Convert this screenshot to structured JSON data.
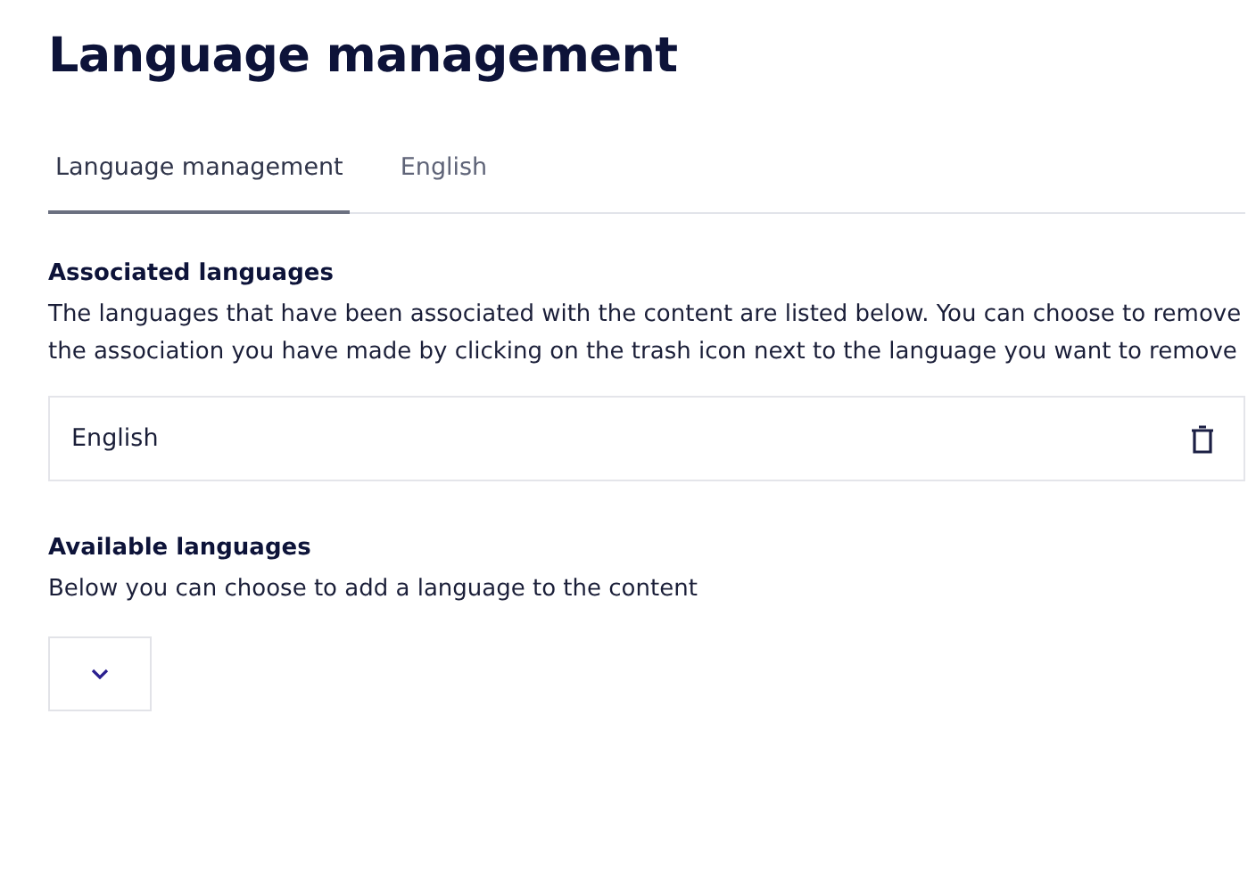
{
  "title": "Language management",
  "tabs": [
    {
      "label": "Language management",
      "selected": true
    },
    {
      "label": "English",
      "selected": false
    }
  ],
  "associated": {
    "heading": "Associated languages",
    "description": "The languages that have been associated with the content are listed below. You can choose to remove the association you have made by clicking on the trash icon next to the language you want to remove",
    "languages": [
      "English"
    ]
  },
  "available": {
    "heading": "Available languages",
    "description": "Below you can choose to add a language to the content"
  }
}
